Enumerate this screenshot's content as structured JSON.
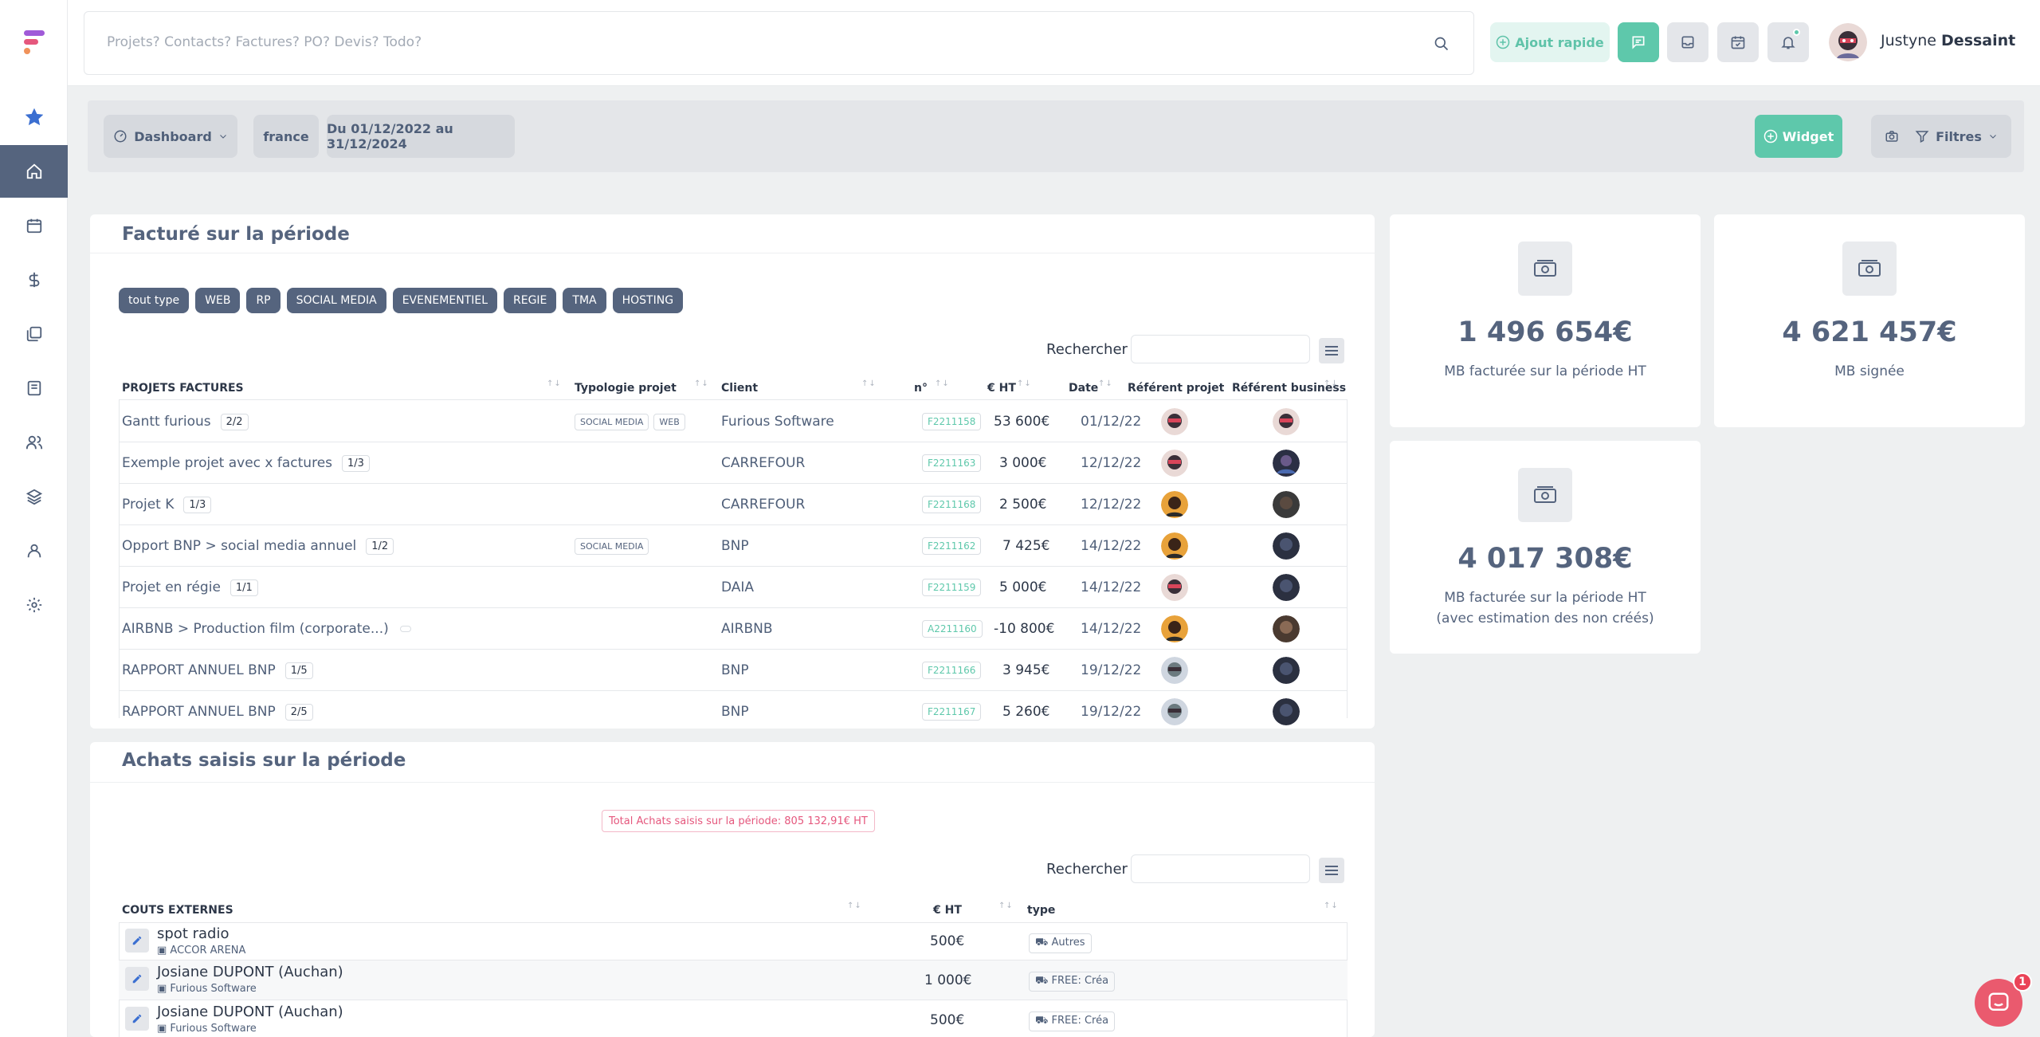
{
  "search": {
    "placeholder": "Projets? Contacts? Factures? PO? Devis? Todo?"
  },
  "topbar": {
    "quick_add": "Ajout rapide",
    "user_first": "Justyne",
    "user_last": "Dessaint",
    "accent": "#5ec8ab"
  },
  "sidebar": {
    "items": [
      "favorites-icon",
      "home-icon",
      "calendar-icon",
      "dollar-icon",
      "documents-icon",
      "invoice-icon",
      "contacts-icon",
      "layers-icon",
      "user-icon",
      "settings-icon"
    ],
    "active": "home-icon"
  },
  "filters": {
    "dashboard": "Dashboard",
    "country": "france",
    "period": "Du 01/12/2022 au 31/12/2024",
    "widget": "Widget",
    "filters": "Filtres"
  },
  "facture": {
    "title": "Facturé sur la période",
    "tags": [
      "tout type",
      "WEB",
      "RP",
      "SOCIAL MEDIA",
      "EVENEMENTIEL",
      "REGIE",
      "TMA",
      "HOSTING"
    ],
    "search_label": "Rechercher",
    "columns": [
      "PROJETS FACTURES",
      "Typologie projet",
      "Client",
      "n°",
      "€ HT",
      "Date",
      "Référent projet",
      "Référent business"
    ],
    "rows": [
      {
        "project": "Gantt furious",
        "count": "2/2",
        "typologies": [
          "SOCIAL MEDIA",
          "WEB"
        ],
        "client": "Furious Software",
        "num": "F2211158",
        "ht": "53 600€",
        "date": "01/12/22"
      },
      {
        "project": "Exemple projet avec x factures",
        "count": "1/3",
        "typologies": [],
        "client": "CARREFOUR",
        "num": "F2211163",
        "ht": "3 000€",
        "date": "12/12/22"
      },
      {
        "project": "Projet K",
        "count": "1/3",
        "typologies": [],
        "client": "CARREFOUR",
        "num": "F2211168",
        "ht": "2 500€",
        "date": "12/12/22"
      },
      {
        "project": "Opport BNP > social media annuel",
        "count": "1/2",
        "typologies": [
          "SOCIAL MEDIA"
        ],
        "client": "BNP",
        "num": "F2211162",
        "ht": "7 425€",
        "date": "14/12/22"
      },
      {
        "project": "Projet en régie",
        "count": "1/1",
        "typologies": [],
        "client": "DAIA",
        "num": "F2211159",
        "ht": "5 000€",
        "date": "14/12/22"
      },
      {
        "project": "AIRBNB > Production film (corporate...)",
        "count": "",
        "typologies": [],
        "client": "AIRBNB",
        "num": "A2211160",
        "ht": "-10 800€",
        "date": "14/12/22"
      },
      {
        "project": "RAPPORT ANNUEL BNP",
        "count": "1/5",
        "typologies": [],
        "client": "BNP",
        "num": "F2211166",
        "ht": "3 945€",
        "date": "19/12/22"
      },
      {
        "project": "RAPPORT ANNUEL BNP",
        "count": "2/5",
        "typologies": [],
        "client": "BNP",
        "num": "F2211167",
        "ht": "5 260€",
        "date": "19/12/22"
      }
    ]
  },
  "kpis": [
    {
      "value": "1 496 654€",
      "label": "MB facturée sur la période HT",
      "label2": ""
    },
    {
      "value": "4 621 457€",
      "label": "MB signée",
      "label2": ""
    },
    {
      "value": "4 017 308€",
      "label": "MB facturée sur la période HT",
      "label2": "(avec estimation des non créés)"
    }
  ],
  "achats": {
    "title": "Achats saisis sur la période",
    "total": "Total Achats saisis sur la période: 805 132,91€ HT",
    "search_label": "Rechercher",
    "columns": [
      "COUTS EXTERNES",
      "€ HT",
      "type"
    ],
    "rows": [
      {
        "name": "spot radio",
        "company": "ACCOR ARENA",
        "ht": "500€",
        "type": "Autres"
      },
      {
        "name": "Josiane DUPONT (Auchan)",
        "company": "Furious Software",
        "ht": "1 000€",
        "type": "FREE: Créa"
      },
      {
        "name": "Josiane DUPONT (Auchan)",
        "company": "Furious Software",
        "ht": "500€",
        "type": "FREE: Créa"
      }
    ]
  },
  "chat": {
    "badge": "1"
  }
}
